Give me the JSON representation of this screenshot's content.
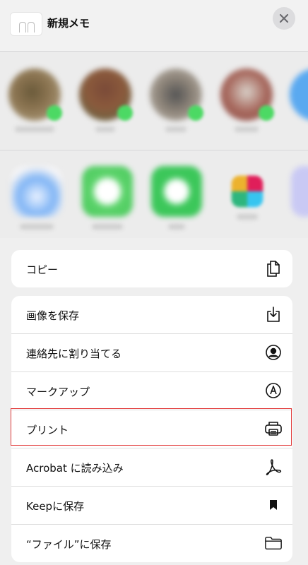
{
  "header": {
    "title": "新規メモ"
  },
  "actions_top": [
    {
      "label": "コピー",
      "icon": "copy-icon"
    }
  ],
  "actions": [
    {
      "label": "画像を保存",
      "icon": "save-image-icon"
    },
    {
      "label": "連絡先に割り当てる",
      "icon": "contact-icon"
    },
    {
      "label": "マークアップ",
      "icon": "markup-icon"
    },
    {
      "label": "プリント",
      "icon": "printer-icon"
    },
    {
      "label": "Acrobat に読み込み",
      "icon": "acrobat-icon"
    },
    {
      "label": "Keepに保存",
      "icon": "bookmark-icon"
    },
    {
      "label": "“ファイル”に保存",
      "icon": "folder-icon"
    }
  ],
  "colors": {
    "highlight": "#e23b3b",
    "badge": "#4cd964"
  }
}
